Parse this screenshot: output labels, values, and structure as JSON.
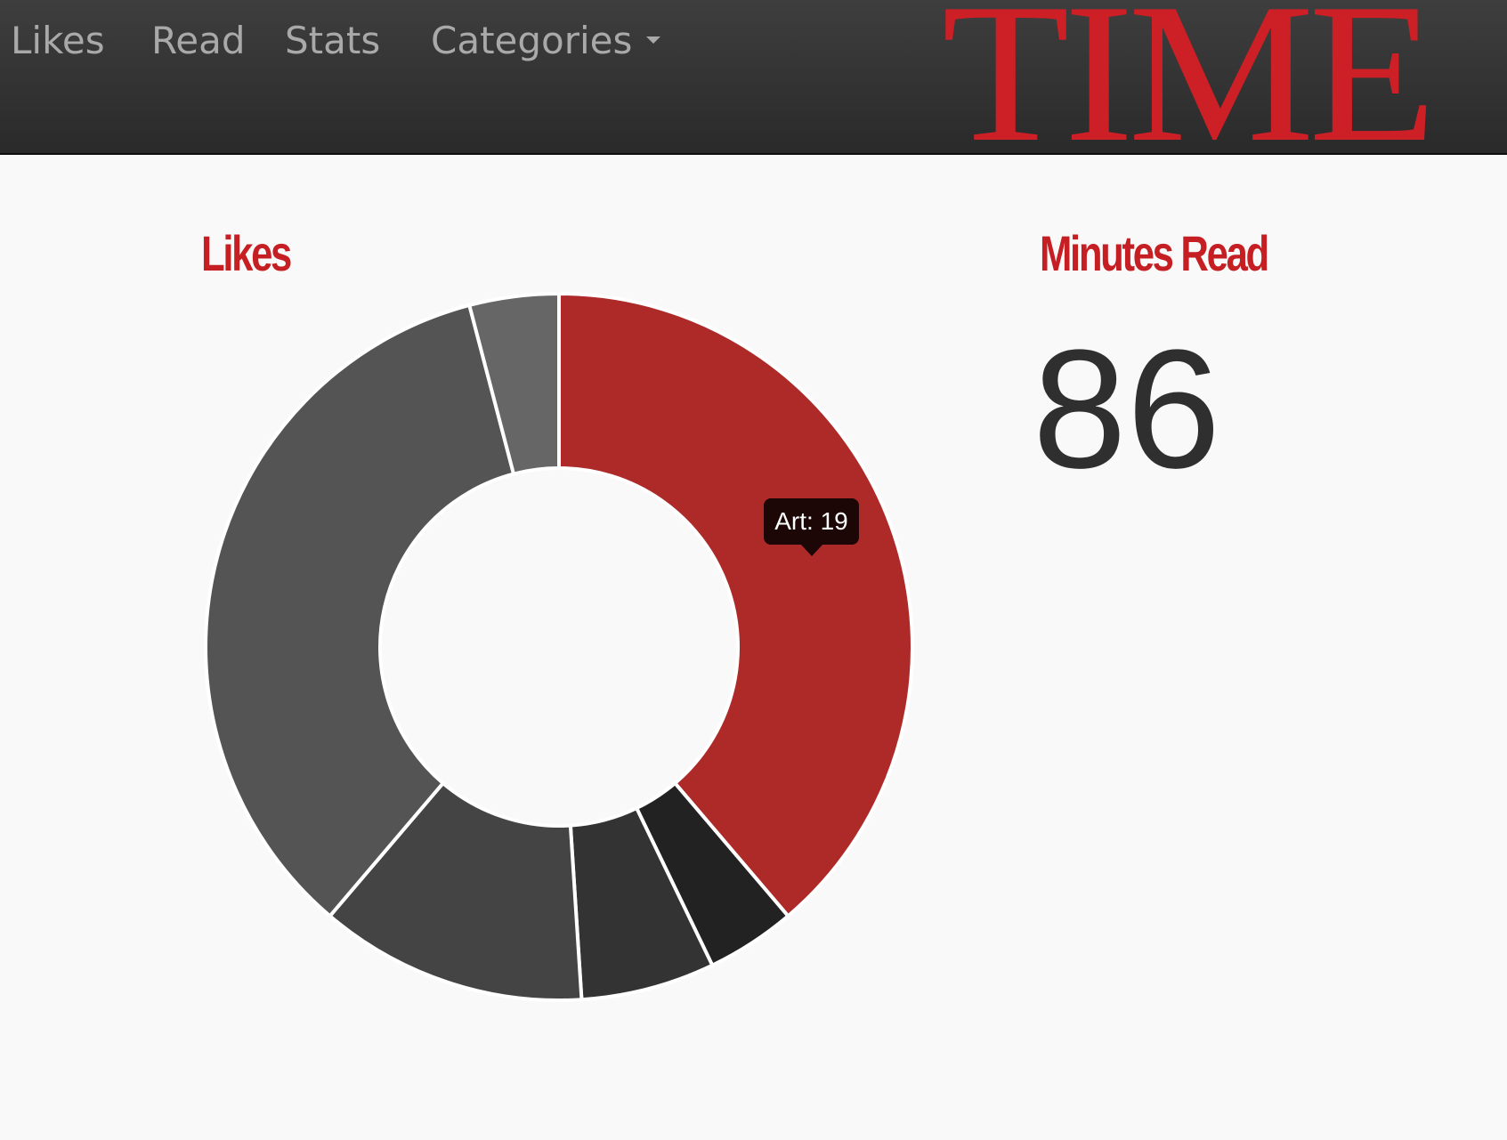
{
  "nav": {
    "items": [
      {
        "label": "Likes"
      },
      {
        "label": "Read"
      },
      {
        "label": "Stats"
      },
      {
        "label": "Categories"
      }
    ],
    "categories_caret_icon": "caret-down-icon"
  },
  "logo": {
    "text": "TIME",
    "color": "#cc1f26"
  },
  "likes_panel": {
    "title": "Likes",
    "tooltip": "Art: 19"
  },
  "minutes_panel": {
    "title": "Minutes Read",
    "value": "86"
  },
  "colors": {
    "accent": "#c51f24",
    "navbar": "#333333",
    "background": "#f9f9f9"
  },
  "chart_data": {
    "type": "pie",
    "donut": true,
    "slices": [
      {
        "label": "Art",
        "value": 19,
        "color": "#ad2a29"
      },
      {
        "value": 2,
        "color": "#222222"
      },
      {
        "value": 3,
        "color": "#333333"
      },
      {
        "value": 6,
        "color": "#444444"
      },
      {
        "value": 17,
        "color": "#545454"
      },
      {
        "value": 2,
        "color": "#666666"
      }
    ]
  }
}
